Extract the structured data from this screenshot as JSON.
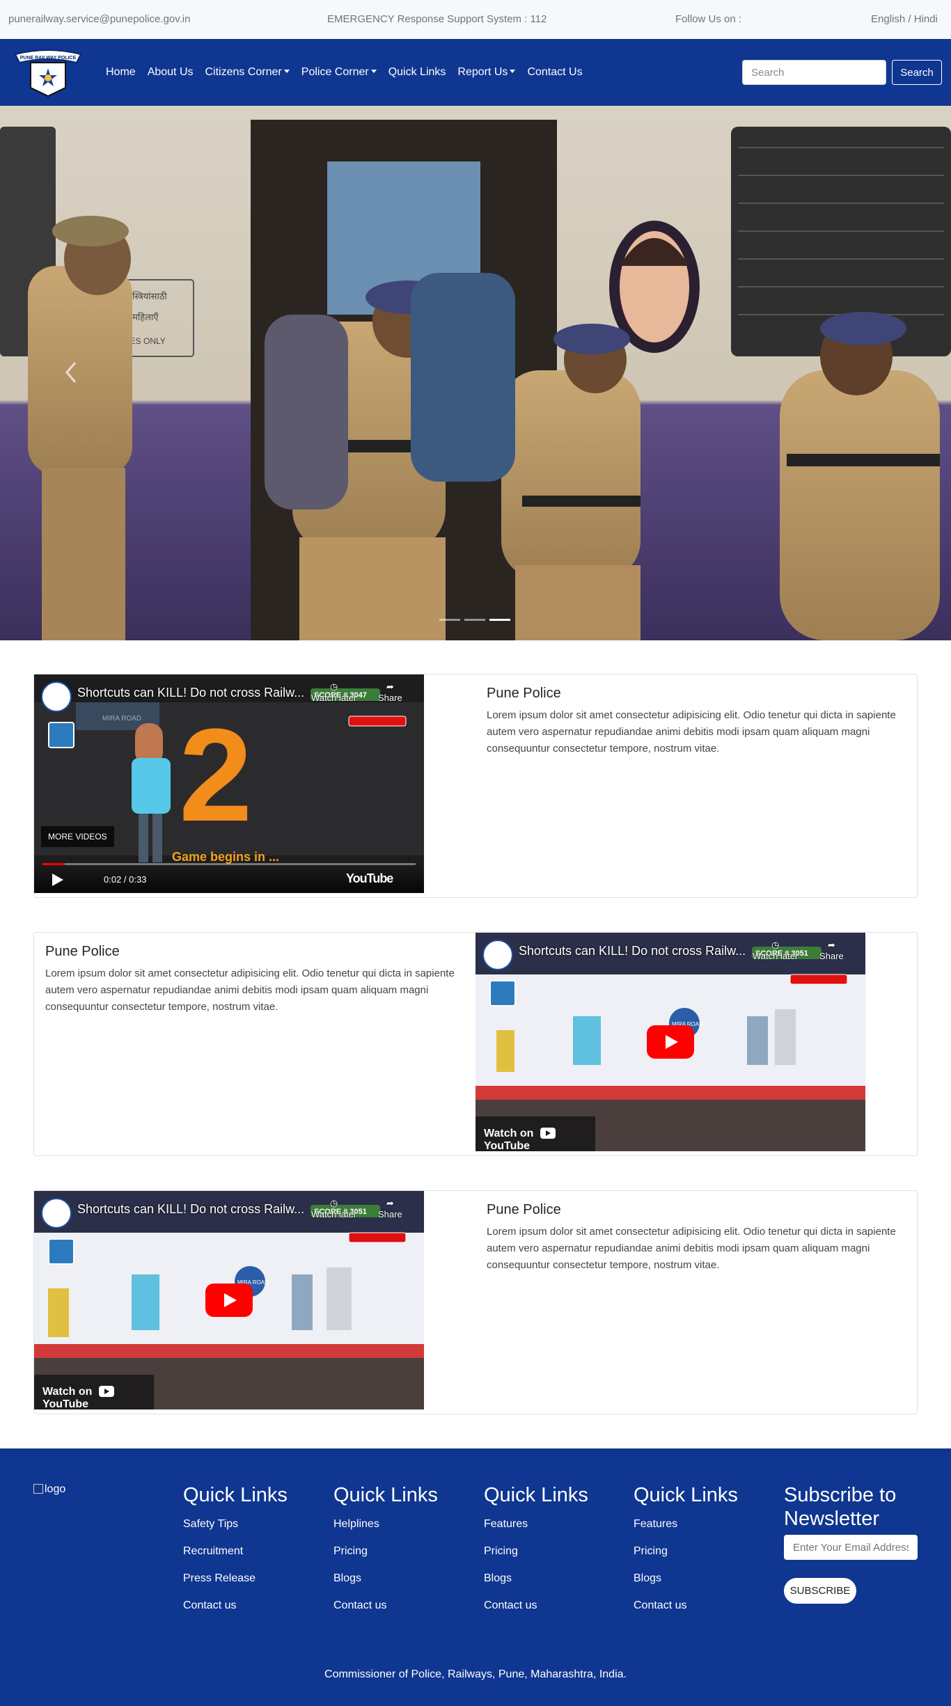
{
  "topbar": {
    "email": "punerailway.service@punepolice.gov.in",
    "emergency": "EMERGENCY Response Support System : 112",
    "follow": "Follow Us on :",
    "language": "English / Hindi"
  },
  "nav": {
    "logo_text": "PUNE RAILWAY POLICE",
    "items": [
      {
        "label": "Home",
        "dropdown": false
      },
      {
        "label": "About Us",
        "dropdown": false
      },
      {
        "label": "Citizens Corner",
        "dropdown": true
      },
      {
        "label": "Police Corner",
        "dropdown": true
      },
      {
        "label": "Quick Links",
        "dropdown": false
      },
      {
        "label": "Report Us",
        "dropdown": true
      },
      {
        "label": "Contact Us",
        "dropdown": false
      }
    ],
    "search_placeholder": "Search",
    "search_button": "Search"
  },
  "hero": {
    "slides": 3,
    "active_slide": 3,
    "sign_lines": [
      "केवल स्त्रियांसाठी",
      "केवल महिलाएँ",
      "LADIES ONLY"
    ]
  },
  "cards": [
    {
      "title": "Pune Police",
      "text": "Lorem ipsum dolor sit amet consectetur adipisicing elit. Odio tenetur qui dicta in sapiente autem vero aspernatur repudiandae animi debitis modi ipsam quam aliquam magni consequuntur consectetur tempore, nostrum vitae.",
      "video": {
        "title": "Shortcuts can KILL! Do not cross Railw...",
        "watch_later": "Watch later",
        "share": "Share",
        "score": "SCORE # 3047",
        "overlay_number": "2",
        "caption": "Game begins in ...",
        "more_videos": "MORE VIDEOS",
        "time": "0:02 / 0:33",
        "brand": "YouTube",
        "progress": 0.06
      }
    },
    {
      "title": "Pune Police",
      "text": "Lorem ipsum dolor sit amet consectetur adipisicing elit. Odio tenetur qui dicta in sapiente autem vero aspernatur repudiandae animi debitis modi ipsam quam aliquam magni consequuntur consectetur tempore, nostrum vitae.",
      "video": {
        "title": "Shortcuts can KILL! Do not cross Railw...",
        "watch_later": "Watch later",
        "share": "Share",
        "score": "SCORE # 3051",
        "station": "MIRA ROAD",
        "watch_on": "Watch on",
        "brand": "YouTube"
      }
    },
    {
      "title": "Pune Police",
      "text": "Lorem ipsum dolor sit amet consectetur adipisicing elit. Odio tenetur qui dicta in sapiente autem vero aspernatur repudiandae animi debitis modi ipsam quam aliquam magni consequuntur consectetur tempore, nostrum vitae.",
      "video": {
        "title": "Shortcuts can KILL! Do not cross Railw...",
        "watch_later": "Watch later",
        "share": "Share",
        "score": "SCORE # 3051",
        "station": "MIRA ROAD",
        "watch_on": "Watch on",
        "brand": "YouTube"
      }
    }
  ],
  "footer": {
    "logo_alt": "logo",
    "columns": [
      {
        "title": "Quick Links",
        "links": [
          "Safety Tips",
          "Recruitment",
          "Press Release",
          "Contact us"
        ]
      },
      {
        "title": "Quick Links",
        "links": [
          "Helplines",
          "Pricing",
          "Blogs",
          "Contact us"
        ]
      },
      {
        "title": "Quick Links",
        "links": [
          "Features",
          "Pricing",
          "Blogs",
          "Contact us"
        ]
      },
      {
        "title": "Quick Links",
        "links": [
          "Features",
          "Pricing",
          "Blogs",
          "Contact us"
        ]
      }
    ],
    "subscribe_title": "Subscribe to Newsletter",
    "email_placeholder": "Enter Your Email Address",
    "subscribe_button": "SUBSCRIBE",
    "copyright": "Commissioner of Police, Railways, Pune, Maharashtra, India."
  },
  "colors": {
    "brand_blue": "#0f3690",
    "topbar_bg": "#f7f8fa",
    "youtube_red": "#ff0000"
  }
}
